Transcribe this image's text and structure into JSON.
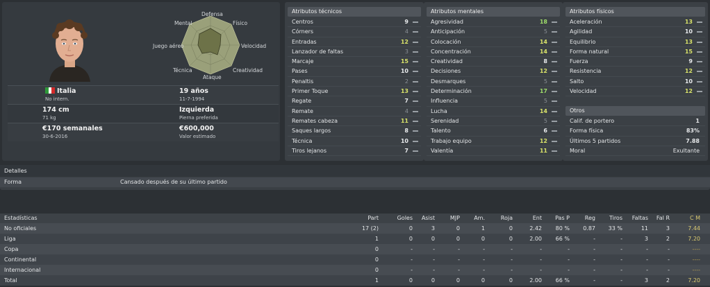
{
  "profile": {
    "radar_labels": {
      "top": "Defensa",
      "top_left": "Mental",
      "top_right": "Físico",
      "left": "Juego aéreo",
      "right": "Velocidad",
      "bottom_left": "Técnica",
      "bottom_right": "Creatividad",
      "bottom": "Ataque"
    },
    "nation": "Italia",
    "caps": "No intern.",
    "age": "19 años",
    "dob": "11-7-1994",
    "height": "174 cm",
    "weight": "71 kg",
    "foot": "Izquierda",
    "foot_label": "Pierna preferida",
    "wage": "€170 semanales",
    "contract_end": "30-6-2016",
    "value": "€600,000",
    "value_label": "Valor estimado",
    "flag_colors": [
      "#2e9a3a",
      "#ffffff",
      "#d42a2a"
    ]
  },
  "technical": {
    "title": "Atributos técnicos",
    "items": [
      {
        "label": "Centros",
        "value": "9"
      },
      {
        "label": "Córners",
        "value": "4"
      },
      {
        "label": "Entradas",
        "value": "12"
      },
      {
        "label": "Lanzador de faltas",
        "value": "3"
      },
      {
        "label": "Marcaje",
        "value": "15"
      },
      {
        "label": "Pases",
        "value": "10"
      },
      {
        "label": "Penaltis",
        "value": "2"
      },
      {
        "label": "Primer Toque",
        "value": "13"
      },
      {
        "label": "Regate",
        "value": "7"
      },
      {
        "label": "Remate",
        "value": "4"
      },
      {
        "label": "Remates cabeza",
        "value": "11"
      },
      {
        "label": "Saques largos",
        "value": "8"
      },
      {
        "label": "Técnica",
        "value": "10"
      },
      {
        "label": "Tiros lejanos",
        "value": "7"
      }
    ]
  },
  "mental": {
    "title": "Atributos mentales",
    "items": [
      {
        "label": "Agresividad",
        "value": "18"
      },
      {
        "label": "Anticipación",
        "value": "5"
      },
      {
        "label": "Colocación",
        "value": "14"
      },
      {
        "label": "Concentración",
        "value": "14"
      },
      {
        "label": "Creatividad",
        "value": "8"
      },
      {
        "label": "Decisiones",
        "value": "12"
      },
      {
        "label": "Desmarques",
        "value": "5"
      },
      {
        "label": "Determinación",
        "value": "17"
      },
      {
        "label": "Influencia",
        "value": "5"
      },
      {
        "label": "Lucha",
        "value": "14"
      },
      {
        "label": "Serenidad",
        "value": "5"
      },
      {
        "label": "Talento",
        "value": "6"
      },
      {
        "label": "Trabajo equipo",
        "value": "12"
      },
      {
        "label": "Valentía",
        "value": "11"
      }
    ]
  },
  "physical": {
    "title": "Atributos físicos",
    "items": [
      {
        "label": "Aceleración",
        "value": "13"
      },
      {
        "label": "Agilidad",
        "value": "10"
      },
      {
        "label": "Equilibrio",
        "value": "13"
      },
      {
        "label": "Forma natural",
        "value": "15"
      },
      {
        "label": "Fuerza",
        "value": "9"
      },
      {
        "label": "Resistencia",
        "value": "12"
      },
      {
        "label": "Salto",
        "value": "10"
      },
      {
        "label": "Velocidad",
        "value": "12"
      }
    ]
  },
  "otros": {
    "title": "Otros",
    "items": [
      {
        "label": "Calif. de portero",
        "value": "1"
      },
      {
        "label": "Forma física",
        "value": "83%"
      },
      {
        "label": "Últimos 5 partidos",
        "value": "7.88"
      },
      {
        "label": "Moral",
        "value": "Exultante"
      }
    ]
  },
  "detalles": {
    "title": "Detalles",
    "row_label": "Forma",
    "row_value": "Cansado después de su último partido"
  },
  "stats": {
    "title": "Estadísticas",
    "columns": [
      "Part",
      "Goles",
      "Asist",
      "MJP",
      "Am.",
      "Roja",
      "Ent",
      "Pas P",
      "Reg",
      "Tiros",
      "Faltas",
      "Fal R",
      "C M"
    ],
    "rows": [
      {
        "name": "No oficiales",
        "cells": [
          "17 (2)",
          "0",
          "3",
          "0",
          "1",
          "0",
          "2.42",
          "80 %",
          "0.87",
          "33 %",
          "11",
          "3",
          "7.44"
        ]
      },
      {
        "name": "Liga",
        "cells": [
          "1",
          "0",
          "0",
          "0",
          "0",
          "0",
          "2.00",
          "66 %",
          "-",
          "-",
          "3",
          "2",
          "7.20"
        ]
      },
      {
        "name": "Copa",
        "cells": [
          "0",
          "-",
          "-",
          "-",
          "-",
          "-",
          "-",
          "-",
          "-",
          "-",
          "-",
          "-",
          "----"
        ]
      },
      {
        "name": "Continental",
        "cells": [
          "0",
          "-",
          "-",
          "-",
          "-",
          "-",
          "-",
          "-",
          "-",
          "-",
          "-",
          "-",
          "----"
        ]
      },
      {
        "name": "Internacional",
        "cells": [
          "0",
          "-",
          "-",
          "-",
          "-",
          "-",
          "-",
          "-",
          "-",
          "-",
          "-",
          "-",
          "----"
        ]
      },
      {
        "name": "Total",
        "cells": [
          "1",
          "0",
          "0",
          "0",
          "0",
          "0",
          "2.00",
          "66 %",
          "-",
          "-",
          "3",
          "2",
          "7.20"
        ]
      }
    ]
  }
}
